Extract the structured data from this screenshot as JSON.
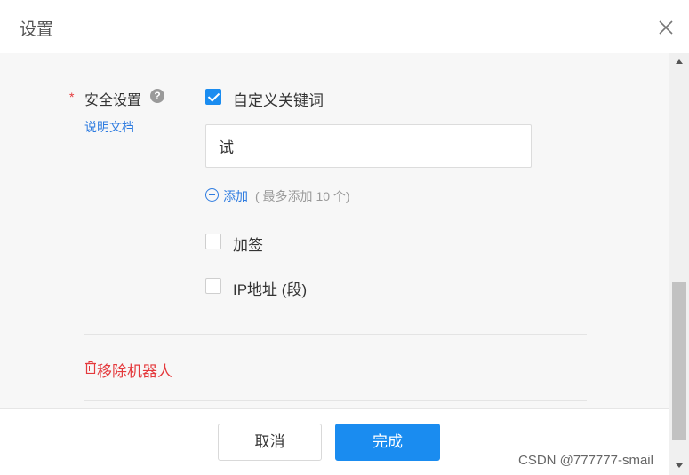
{
  "dialog": {
    "title": "设置",
    "close_icon": "close-icon"
  },
  "security": {
    "required_mark": "*",
    "label": "安全设置",
    "help_icon_glyph": "?",
    "doc_link": "说明文档",
    "options": [
      {
        "label": "自定义关键词",
        "checked": true
      },
      {
        "label": "加签",
        "checked": false
      },
      {
        "label": "IP地址 (段)",
        "checked": false
      }
    ],
    "keyword_value": "试",
    "add_label": "添加",
    "add_hint": "( 最多添加 10 个)"
  },
  "remove_robot": {
    "icon": "trash-icon",
    "label": "移除机器人"
  },
  "buttons": {
    "cancel": "取消",
    "done": "完成"
  },
  "watermark": "CSDN @777777-smail",
  "colors": {
    "accent": "#1a8cf0",
    "link": "#2d7be0",
    "danger": "#e4393c"
  }
}
